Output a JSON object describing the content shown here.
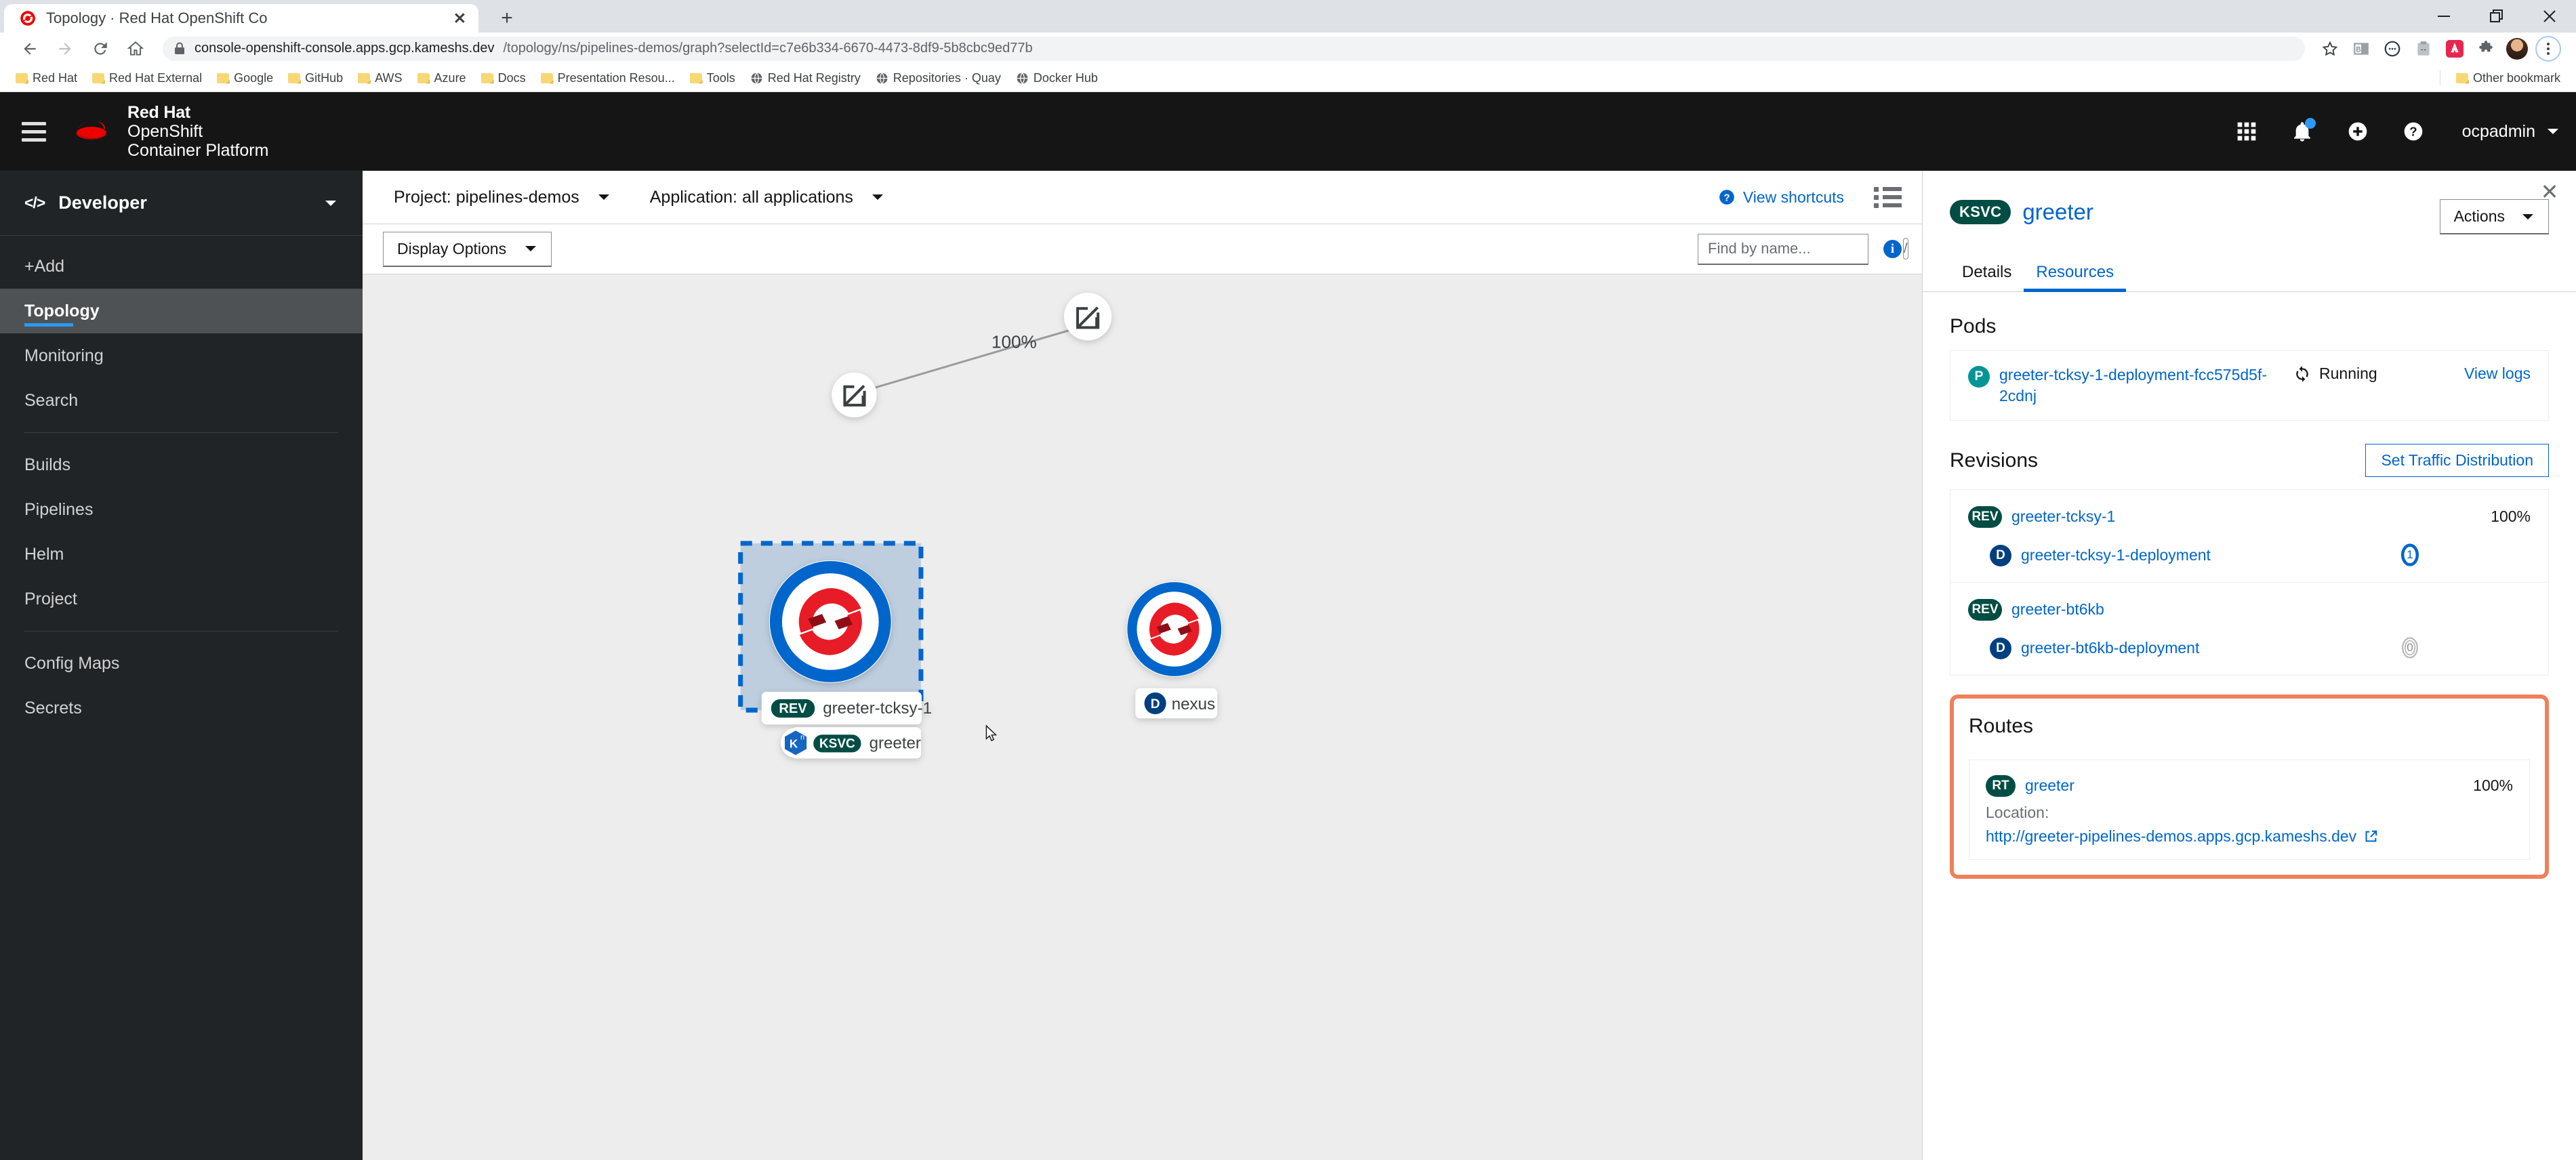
{
  "browser": {
    "tab_title": "Topology · Red Hat OpenShift Co",
    "tab_close_label": "✕",
    "new_tab_label": "+",
    "url_main": "console-openshift-console.apps.gcp.kameshs.dev",
    "url_rest": "/topology/ns/pipelines-demos/graph?selectId=c7e6b334-6670-4473-8df9-5b8cbc9ed77b",
    "minimize_label": "—",
    "restore_label": "❐",
    "close_label": "✕",
    "bookmarks": [
      {
        "label": "Red Hat",
        "icon": "folder-icon"
      },
      {
        "label": "Red Hat External",
        "icon": "folder-icon"
      },
      {
        "label": "Google",
        "icon": "folder-icon"
      },
      {
        "label": "GitHub",
        "icon": "folder-icon"
      },
      {
        "label": "AWS",
        "icon": "folder-icon"
      },
      {
        "label": "Azure",
        "icon": "folder-icon"
      },
      {
        "label": "Docs",
        "icon": "folder-icon"
      },
      {
        "label": "Presentation Resou...",
        "icon": "folder-icon"
      },
      {
        "label": "Tools",
        "icon": "folder-icon"
      },
      {
        "label": "Red Hat Registry",
        "icon": "globe-icon"
      },
      {
        "label": "Repositories · Quay",
        "icon": "globe-icon"
      },
      {
        "label": "Docker Hub",
        "icon": "globe-icon"
      }
    ],
    "other_bookmarks": "Other bookmark"
  },
  "masthead": {
    "brand_line1": "Red Hat",
    "brand_line2": "OpenShift",
    "brand_line3": "Container Platform",
    "username": "ocpadmin",
    "icons": [
      "apps-grid-icon",
      "bell-icon",
      "plus-circle-icon",
      "help-circle-icon"
    ]
  },
  "sidebar": {
    "perspective": "Developer",
    "items": [
      {
        "label": "+Add",
        "active": false
      },
      {
        "label": "Topology",
        "active": true
      },
      {
        "label": "Monitoring",
        "active": false
      },
      {
        "label": "Search",
        "active": false
      },
      {
        "label": "Builds",
        "active": false
      },
      {
        "label": "Pipelines",
        "active": false
      },
      {
        "label": "Helm",
        "active": false
      },
      {
        "label": "Project",
        "active": false
      },
      {
        "label": "Config Maps",
        "active": false
      },
      {
        "label": "Secrets",
        "active": false
      }
    ]
  },
  "toolbar": {
    "project_selector": "Project: pipelines-demos",
    "application_selector": "Application: all applications",
    "view_shortcuts": "View shortcuts",
    "display_options": "Display Options",
    "find_placeholder": "Find by name...",
    "find_value": "",
    "slash_key": "/"
  },
  "graph": {
    "ksvc_group": {
      "traffic_pct": "100%",
      "revision_badge": "REV",
      "revision_name": "greeter-tcksy-1",
      "service_badge": "KSVC",
      "service_name": "greeter",
      "knative_icon": "knative-icon"
    },
    "nexus_node": {
      "badge": "D",
      "name": "nexus"
    }
  },
  "side_panel": {
    "close_label": "✕",
    "badge": "KSVC",
    "title": "greeter",
    "actions_label": "Actions",
    "tabs": [
      {
        "label": "Details",
        "active": false
      },
      {
        "label": "Resources",
        "active": true
      }
    ],
    "pods": {
      "heading": "Pods",
      "items": [
        {
          "badge": "P",
          "name": "greeter-tcksy-1-deployment-fcc575d5f-2cdnj",
          "status": "Running",
          "logs_label": "View logs"
        }
      ]
    },
    "revisions": {
      "heading": "Revisions",
      "traffic_button": "Set Traffic Distribution",
      "items": [
        {
          "badge": "REV",
          "name": "greeter-tcksy-1",
          "percent": "100%",
          "deployment_badge": "D",
          "deployment_name": "greeter-tcksy-1-deployment",
          "pod_count": "1",
          "pod_state": "active"
        },
        {
          "badge": "REV",
          "name": "greeter-bt6kb",
          "percent": "",
          "deployment_badge": "D",
          "deployment_name": "greeter-bt6kb-deployment",
          "pod_count": "0",
          "pod_state": "idle"
        }
      ]
    },
    "routes": {
      "heading": "Routes",
      "highlight_color": "#f0805a",
      "items": [
        {
          "badge": "RT",
          "name": "greeter",
          "percent": "100%",
          "location_label": "Location:",
          "url": "http://greeter-pipelines-demos.apps.gcp.kameshs.dev"
        }
      ]
    }
  },
  "colors": {
    "accent_blue": "#06c",
    "knative_teal": "#004d44",
    "masthead_black": "#151515",
    "sidebar_dark": "#212427",
    "highlight_orange": "#f0805a",
    "redhat_red": "#ee0000",
    "graph_bg": "#ededed"
  }
}
